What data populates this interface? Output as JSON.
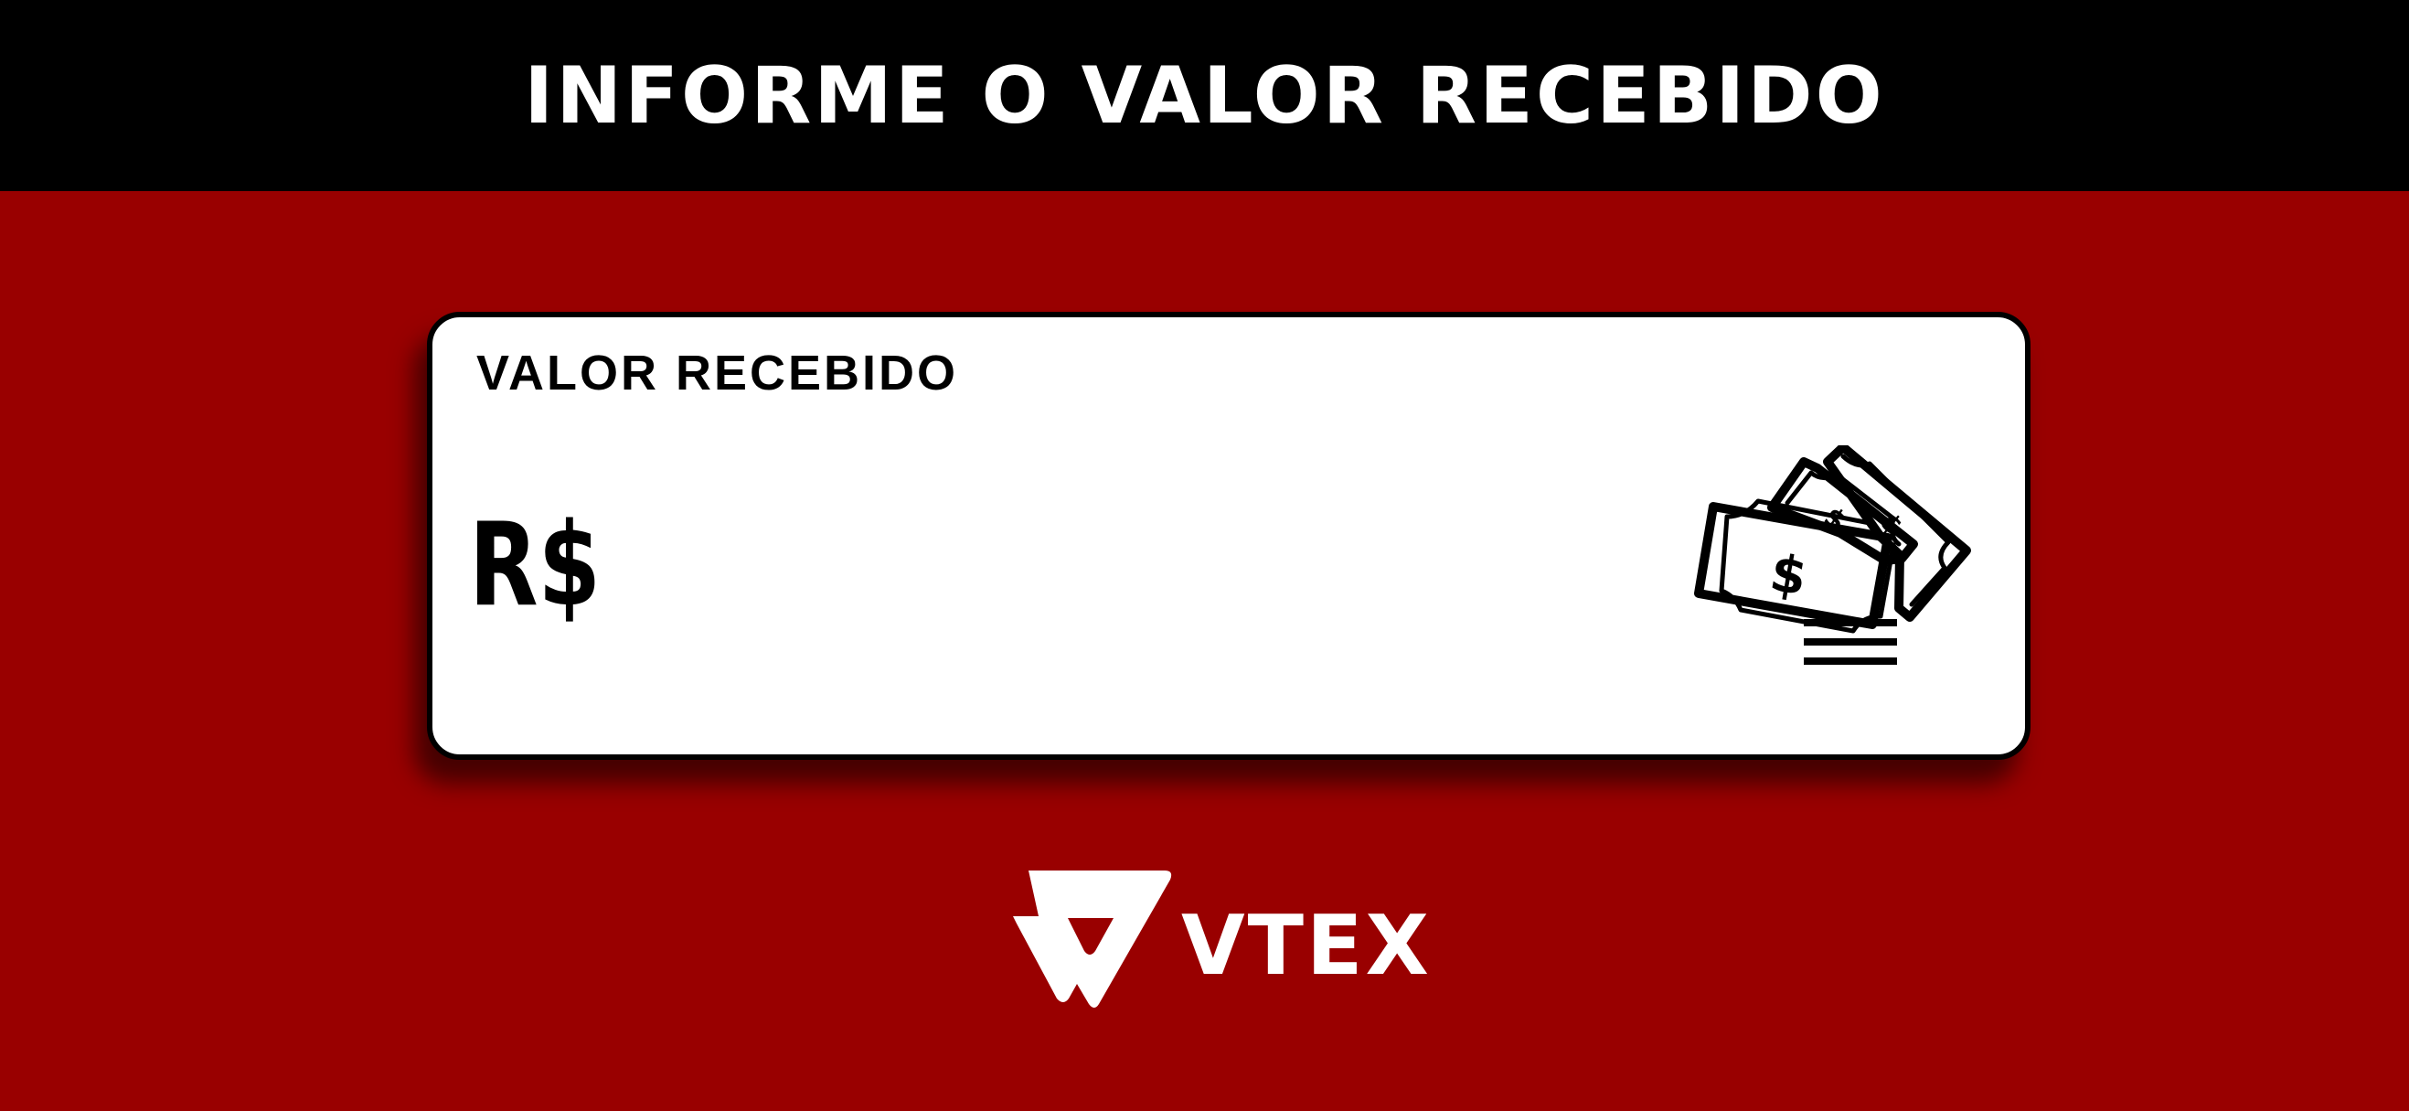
{
  "colors": {
    "background": "#990000",
    "header_background": "#000000",
    "header_text": "#ffffff",
    "card_background": "#ffffff",
    "card_border": "#000000",
    "brand": "#ffffff"
  },
  "header": {
    "title": "INFORME O VALOR RECEBIDO"
  },
  "value_field": {
    "label": "VALOR RECEBIDO",
    "currency_symbol": "R$",
    "value": "",
    "icon": "cash-money-icon"
  },
  "footer": {
    "brand_icon": "vtex-logo-icon",
    "brand_name": "VTEX"
  }
}
